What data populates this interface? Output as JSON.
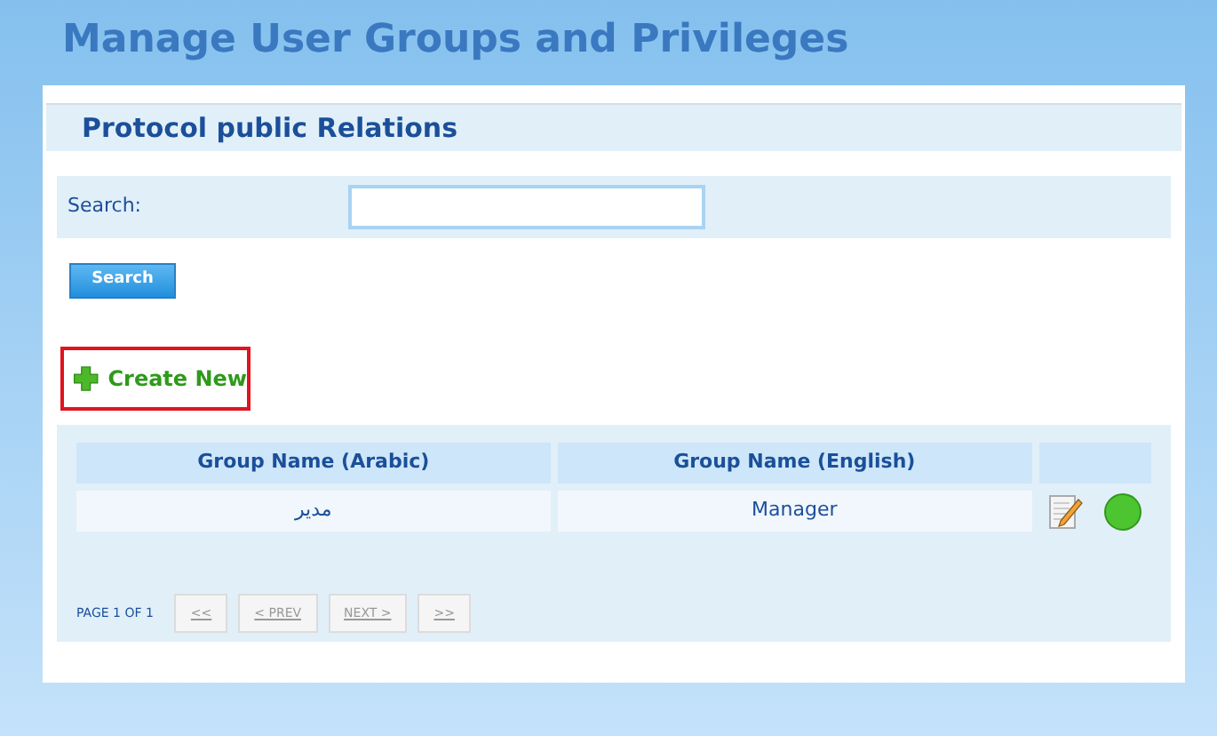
{
  "page_title": "Manage User Groups and Privileges",
  "section_title": "Protocol public Relations",
  "search": {
    "label": "Search:",
    "button": "Search"
  },
  "create_new": "Create New",
  "table": {
    "columns": [
      "Group Name (Arabic)",
      "Group Name (English)"
    ],
    "rows": [
      {
        "cells": [
          "مدير",
          "Manager"
        ],
        "active": true
      }
    ]
  },
  "pager": {
    "info": "PAGE 1 OF 1",
    "buttons": [
      "<<",
      "< PREV",
      "NEXT >",
      ">>"
    ]
  }
}
